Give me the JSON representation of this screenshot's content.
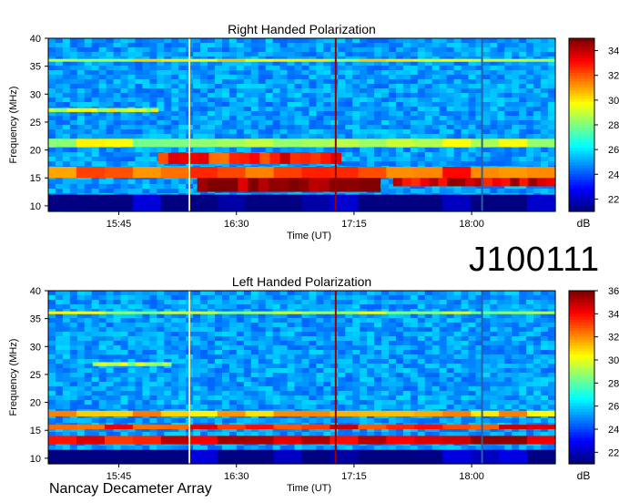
{
  "observation_id": "J100111",
  "instrument": "Nancay Decameter Array",
  "chart_data": [
    {
      "type": "heatmap",
      "title": "Right Handed Polarization",
      "xlabel": "Time (UT)",
      "ylabel": "Frequency (MHz)",
      "colorbar_label": "dB",
      "x_ticks": [
        "15:45",
        "16:30",
        "17:15",
        "18:00"
      ],
      "x_tick_minutes": [
        945,
        990,
        1035,
        1080
      ],
      "xlim_minutes": [
        918,
        1112
      ],
      "y_ticks": [
        10,
        15,
        20,
        25,
        30,
        35,
        40
      ],
      "ylim": [
        9,
        40
      ],
      "colorbar_ticks": [
        22,
        24,
        26,
        28,
        30,
        32,
        34
      ],
      "colorbar_range": [
        21,
        35
      ],
      "vertical_lines": [
        {
          "time_min": 972,
          "color": "#f0e6a0"
        },
        {
          "time_min": 1028,
          "color": "#990000"
        },
        {
          "time_min": 1084,
          "color": "#2a60a0"
        }
      ],
      "emission_bands": [
        {
          "f1": 9,
          "f2": 12,
          "t1": 918,
          "t2": 1112,
          "level": 0.02
        },
        {
          "f1": 12.5,
          "f2": 15.5,
          "t1": 975,
          "t2": 1045,
          "level": 0.98
        },
        {
          "f1": 13.5,
          "f2": 15.2,
          "t1": 1050,
          "t2": 1112,
          "level": 0.9
        },
        {
          "f1": 15,
          "f2": 17,
          "t1": 918,
          "t2": 1112,
          "level": 0.8
        },
        {
          "f1": 17.5,
          "f2": 19.5,
          "t1": 960,
          "t2": 1030,
          "level": 0.85
        },
        {
          "f1": 20.5,
          "f2": 22,
          "t1": 918,
          "t2": 1112,
          "level": 0.55
        },
        {
          "f1": 26.8,
          "f2": 27.5,
          "t1": 918,
          "t2": 960,
          "level": 0.6
        },
        {
          "f1": 35.8,
          "f2": 36.3,
          "t1": 918,
          "t2": 1112,
          "level": 0.6
        }
      ]
    },
    {
      "type": "heatmap",
      "title": "Left Handed Polarization",
      "xlabel": "Time (UT)",
      "ylabel": "Frequency (MHz)",
      "colorbar_label": "dB",
      "x_ticks": [
        "15:45",
        "16:30",
        "17:15",
        "18:00"
      ],
      "x_tick_minutes": [
        945,
        990,
        1035,
        1080
      ],
      "xlim_minutes": [
        918,
        1112
      ],
      "y_ticks": [
        10,
        15,
        20,
        25,
        30,
        35,
        40
      ],
      "ylim": [
        9,
        40
      ],
      "colorbar_ticks": [
        22,
        24,
        26,
        28,
        30,
        32,
        34,
        36
      ],
      "colorbar_range": [
        21,
        36
      ],
      "vertical_lines": [
        {
          "time_min": 972,
          "color": "#f0e6a0"
        },
        {
          "time_min": 1028,
          "color": "#990000"
        },
        {
          "time_min": 1084,
          "color": "#2a60a0"
        }
      ],
      "emission_bands": [
        {
          "f1": 9,
          "f2": 11.5,
          "t1": 918,
          "t2": 1112,
          "level": 0.02
        },
        {
          "f1": 12.5,
          "f2": 14,
          "t1": 918,
          "t2": 1112,
          "level": 0.9
        },
        {
          "f1": 15.2,
          "f2": 16,
          "t1": 918,
          "t2": 1112,
          "level": 0.85
        },
        {
          "f1": 17.5,
          "f2": 18.5,
          "t1": 918,
          "t2": 1112,
          "level": 0.7
        },
        {
          "f1": 26.5,
          "f2": 27.2,
          "t1": 935,
          "t2": 965,
          "level": 0.55
        },
        {
          "f1": 35.8,
          "f2": 36.3,
          "t1": 918,
          "t2": 1112,
          "level": 0.55
        }
      ]
    }
  ]
}
